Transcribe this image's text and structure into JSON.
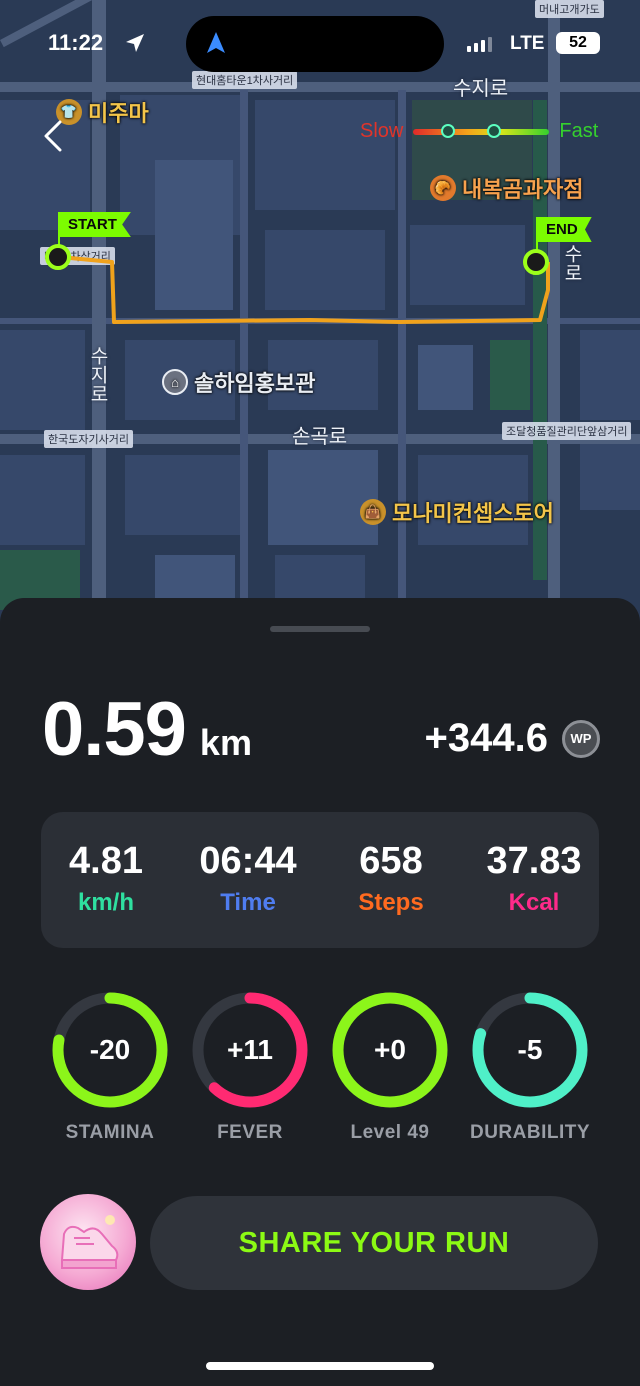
{
  "status_bar": {
    "time": "11:22",
    "network": "LTE",
    "battery": "52"
  },
  "map": {
    "road_labels": [
      "현대홈타운1차사거리",
      "타운2차삼거리",
      "한국도자기사거리",
      "조달청품질관리단앞삼거리",
      "머내고개가도"
    ],
    "streets": [
      "수지로",
      "수지로",
      "손곡로",
      "수로"
    ],
    "pois": [
      {
        "name": "미주마",
        "icon": "shop-icon",
        "color": "#c9912a"
      },
      {
        "name": "내복곰과자점",
        "icon": "bakery-icon",
        "color": "#e27a2c"
      },
      {
        "name": "솔하임홍보관",
        "icon": "building-icon",
        "color": "#6b7180"
      },
      {
        "name": "모나미컨셉스토어",
        "icon": "shopping-bag-icon",
        "color": "#c9912a"
      }
    ],
    "legend": {
      "slow": "Slow",
      "fast": "Fast",
      "slow_color": "#e0342a",
      "fast_color": "#35d02e"
    },
    "start_label": "START",
    "end_label": "END",
    "route_color": "#f0a21c"
  },
  "summary": {
    "distance_value": "0.59",
    "distance_unit": "km",
    "wp_value": "+344.6",
    "wp_badge": "WP"
  },
  "stats": [
    {
      "value": "4.81",
      "label": "km/h",
      "color": "#2fe0a0"
    },
    {
      "value": "06:44",
      "label": "Time",
      "color": "#4f7df0"
    },
    {
      "value": "658",
      "label": "Steps",
      "color": "#ff6a1f"
    },
    {
      "value": "37.83",
      "label": "Kcal",
      "color": "#ff2a8a"
    }
  ],
  "rings": [
    {
      "value": "-20",
      "label": "STAMINA",
      "color": "#8cf51a",
      "fraction": 0.78
    },
    {
      "value": "+11",
      "label": "FEVER",
      "color": "#ff2a72",
      "fraction": 0.62
    },
    {
      "value": "+0",
      "label": "Level 49",
      "color": "#8cf51a",
      "fraction": 1.0
    },
    {
      "value": "-5",
      "label": "DURABILITY",
      "color": "#4ff0c8",
      "fraction": 0.8
    }
  ],
  "share_button": "SHARE YOUR RUN"
}
